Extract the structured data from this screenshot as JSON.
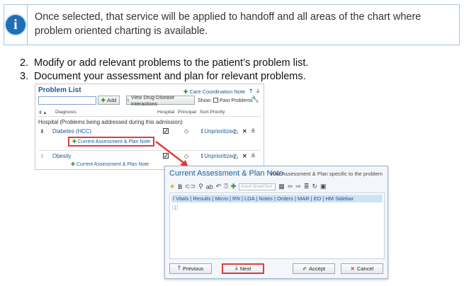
{
  "info": {
    "icon": "info-icon",
    "text": "Once selected, that service will be applied to handoff and all areas of the chart where problem oriented charting is available."
  },
  "steps": [
    {
      "num": "2.",
      "text": "Modify or add relevant problems to the patient’s problem list."
    },
    {
      "num": "3.",
      "text": "Document your assessment and plan for relevant problems."
    }
  ],
  "problem_list": {
    "title": "Problem List",
    "care_coordination": "Care Coordination Note",
    "input_value": "",
    "add_label": "Add",
    "view_ddi_label": "View Drug-Disease Interactions",
    "show_label": "Show:",
    "past_problems_label": "Past Problems",
    "headers": {
      "diagnosis": "Diagnosis",
      "hospital": "Hospital",
      "principal": "Principal",
      "sort_priority": "Sort Priority"
    },
    "group_label": "Hospital (Problems being addressed during this admission)",
    "rows": [
      {
        "diagnosis": "Diabetes (HCC)",
        "hospital_checked": true,
        "priority": "Unprioritized"
      },
      {
        "diagnosis": "Obesity",
        "hospital_checked": true,
        "priority": "Unprioritized"
      }
    ],
    "note_button_label": "Current Assessment & Plan Note"
  },
  "dialog": {
    "title": "Current Assessment & Plan Note",
    "subtitle": "Your Assessment & Plan specific to the problem",
    "smarttext_placeholder": "Insert SmartText",
    "links": "/ Vitals | Results | Micro | RN | LDA | Notes | Orders | MAR | ED | HM Sidebar",
    "previous_label": "Previous",
    "next_label": "Next",
    "accept_label": "Accept",
    "cancel_label": "Cancel"
  },
  "colors": {
    "accent": "#1b5a96",
    "highlight": "#e23b3b",
    "add_green": "#2f9a2f"
  }
}
